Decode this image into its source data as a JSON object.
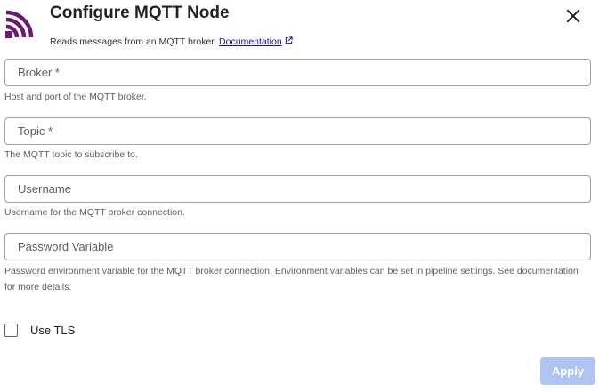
{
  "dialog": {
    "title": "Configure MQTT Node",
    "subtitle": "Reads messages from an MQTT broker.",
    "doc_link_label": "Documentation",
    "close_icon": "close-icon",
    "node_icon": "rss-feed-icon",
    "brand_color": "#6a1b6e"
  },
  "fields": {
    "broker": {
      "placeholder": "Broker *",
      "value": "",
      "helper": "Host and port of the MQTT broker."
    },
    "topic": {
      "placeholder": "Topic *",
      "value": "",
      "helper": "The MQTT topic to subscribe to."
    },
    "username": {
      "placeholder": "Username",
      "value": "",
      "helper": "Username for the MQTT broker connection."
    },
    "password_variable": {
      "placeholder": "Password Variable",
      "value": "",
      "helper": "Password environment variable for the MQTT broker connection. Environment variables can be set in pipeline settings. See documentation for more details."
    }
  },
  "tls": {
    "label": "Use TLS",
    "checked": false
  },
  "actions": {
    "apply_label": "Apply",
    "apply_disabled": true,
    "apply_color": "#aec4f2"
  }
}
